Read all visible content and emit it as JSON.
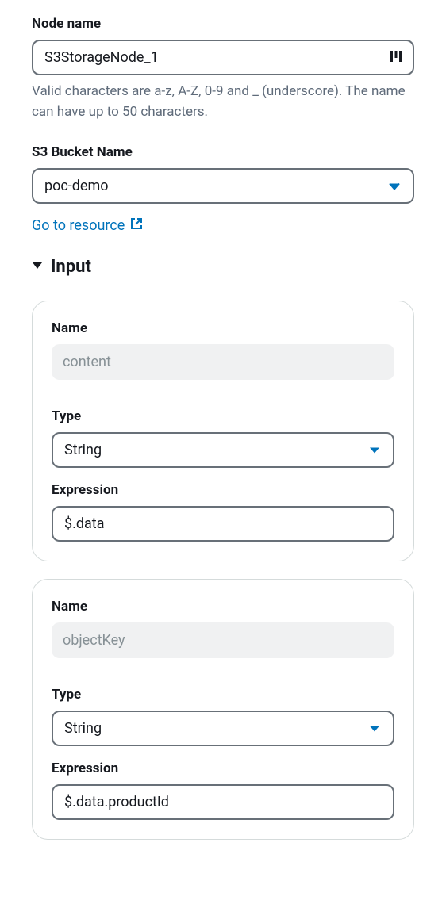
{
  "nodeName": {
    "label": "Node name",
    "value": "S3StorageNode_1",
    "helpText": "Valid characters are a-z, A-Z, 0-9 and _ (underscore). The name can have up to 50 characters."
  },
  "bucketName": {
    "label": "S3 Bucket Name",
    "value": "poc-demo"
  },
  "resourceLink": {
    "label": "Go to resource"
  },
  "inputSection": {
    "title": "Input"
  },
  "inputs": [
    {
      "nameLabel": "Name",
      "nameValue": "content",
      "typeLabel": "Type",
      "typeValue": "String",
      "expressionLabel": "Expression",
      "expressionValue": "$.data"
    },
    {
      "nameLabel": "Name",
      "nameValue": "objectKey",
      "typeLabel": "Type",
      "typeValue": "String",
      "expressionLabel": "Expression",
      "expressionValue": "$.data.productId"
    }
  ]
}
